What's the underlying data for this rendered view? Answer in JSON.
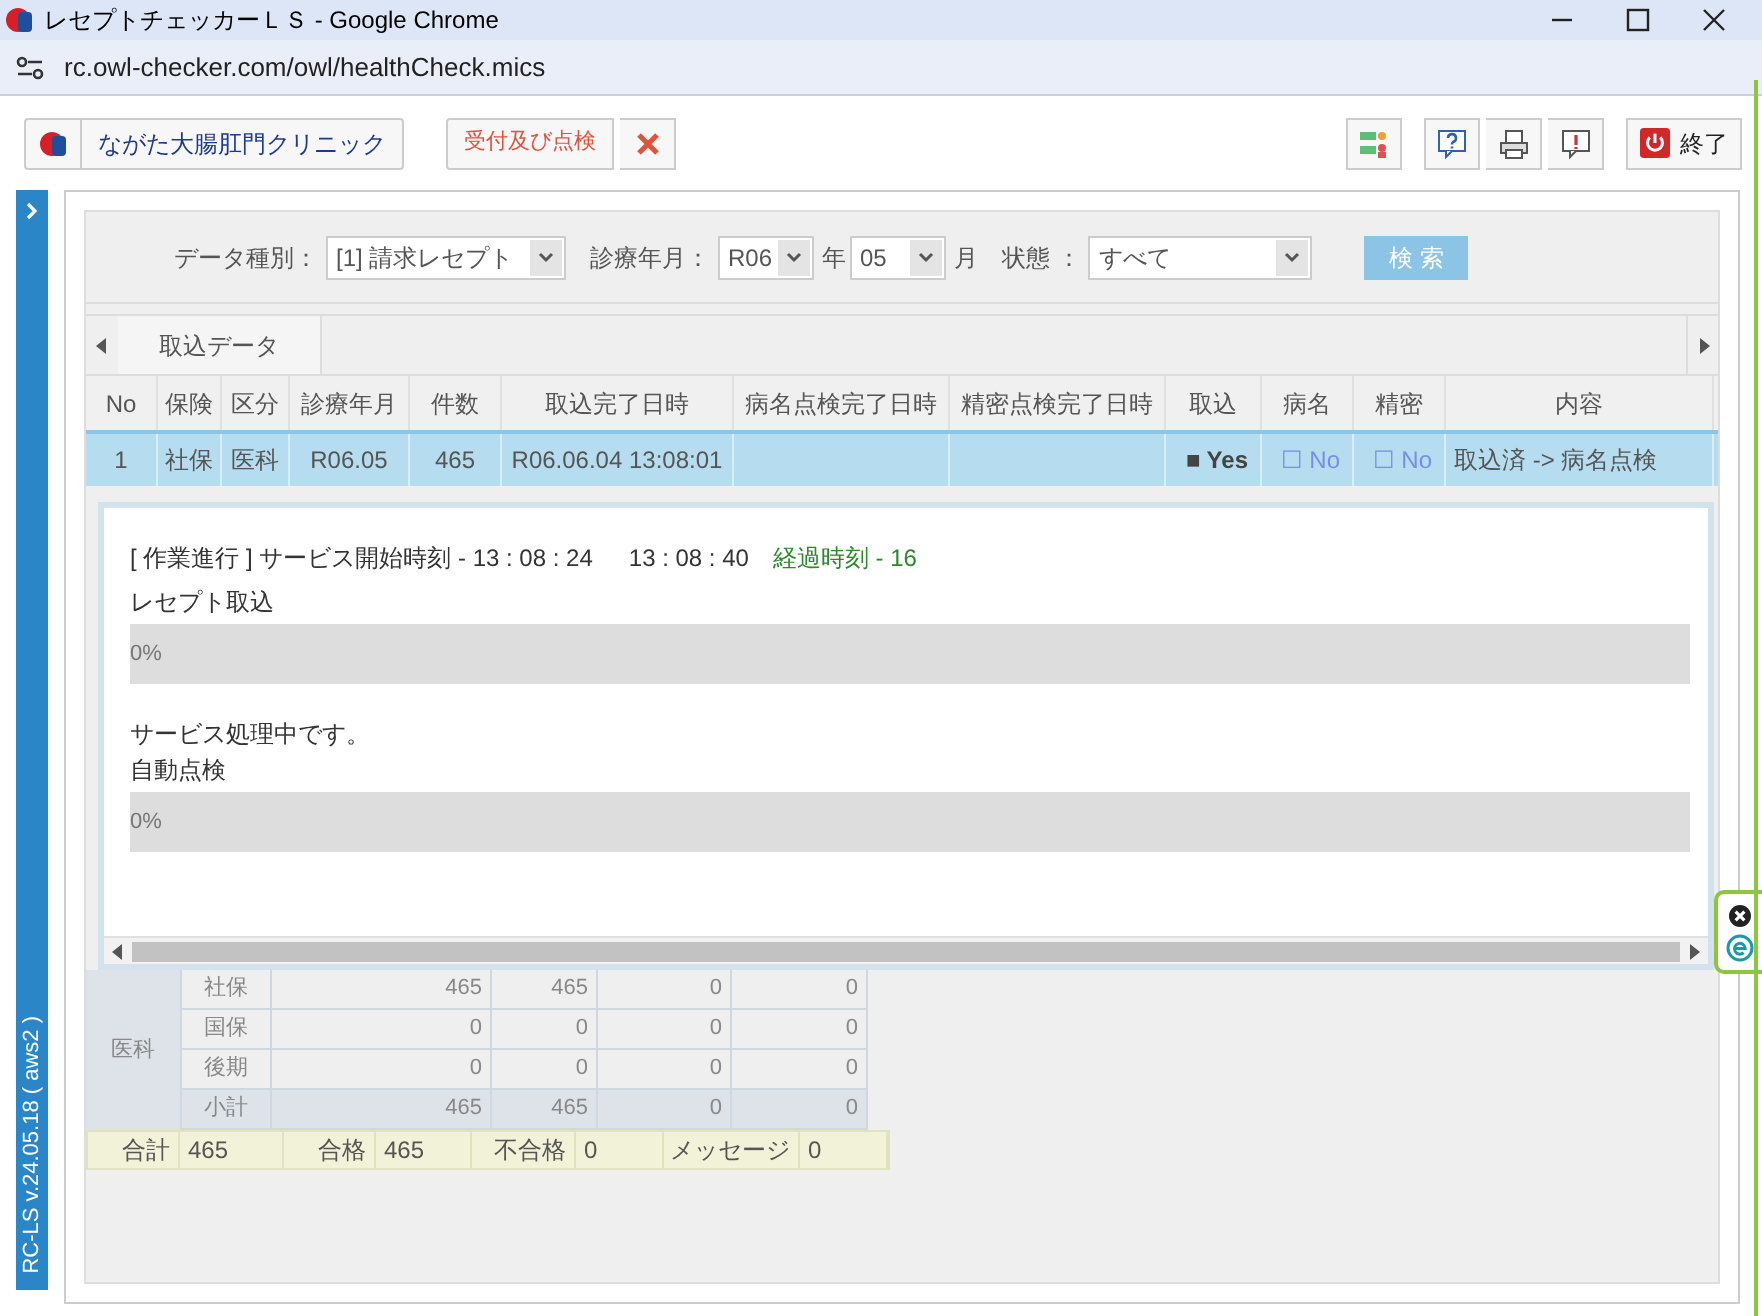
{
  "window": {
    "title": "レセプトチェッカーＬＳ - Google Chrome"
  },
  "address_bar": {
    "url": "rc.owl-checker.com/owl/healthCheck.mics"
  },
  "toolbar": {
    "clinic": "ながた大腸肛門クリニック",
    "reception": "受付及び点検",
    "end": "終了"
  },
  "sidebar": {
    "version": "RC-LS v.24.05.18 ( aws2 )"
  },
  "filters": [
    {
      "label": "データ種別：",
      "value": "[1] 請求レセプト"
    },
    {
      "label": "診療年月：",
      "value": "R06",
      "suffix": "年"
    },
    {
      "value": "05",
      "suffix": "月"
    },
    {
      "label": "状態 ：",
      "value": "すべて"
    }
  ],
  "search_button": "検 索",
  "tabs": [
    {
      "label": "取込データ",
      "selected": true
    }
  ],
  "table": {
    "columns": [
      "No",
      "保険",
      "区分",
      "診療年月",
      "件数",
      "取込完了日時",
      "病名点検完了日時",
      "精密点検完了日時",
      "取込",
      "病名",
      "精密",
      "内容"
    ],
    "rows": [
      {
        "selected": true,
        "cells": [
          "1",
          "社保",
          "医科",
          "R06.05",
          "465",
          "R06.06.04 13:08:01",
          "",
          "",
          "■ Yes",
          "☐ No",
          "☐ No",
          "取込済 -> 病名点検"
        ]
      }
    ]
  },
  "progress_dialog": {
    "status": "[ 作業進行 ] サービス開始時刻 - 13 : 08 : 24",
    "current_time": "13 : 08 : 40",
    "elapsed": "経過時刻 - 16",
    "tasks": [
      {
        "label": "レセプト取込",
        "level": 0,
        "reading": "0%"
      },
      {
        "message": "サービス処理中です。",
        "label": "自動点検",
        "level": 0,
        "reading": "0%"
      }
    ]
  },
  "summary": {
    "group": "医科",
    "rows": [
      {
        "label": "社保",
        "values": [
          "465",
          "465",
          "0",
          "0"
        ],
        "subtotal": false
      },
      {
        "label": "国保",
        "values": [
          "0",
          "0",
          "0",
          "0"
        ],
        "subtotal": false
      },
      {
        "label": "後期",
        "values": [
          "0",
          "0",
          "0",
          "0"
        ],
        "subtotal": false
      },
      {
        "label": "小計",
        "values": [
          "465",
          "465",
          "0",
          "0"
        ],
        "subtotal": true
      }
    ],
    "totals": [
      {
        "label": "合計",
        "value": "465"
      },
      {
        "label": "合格",
        "value": "465"
      },
      {
        "label": "不合格",
        "value": "0"
      },
      {
        "label": "メッセージ",
        "value": "0"
      }
    ]
  }
}
